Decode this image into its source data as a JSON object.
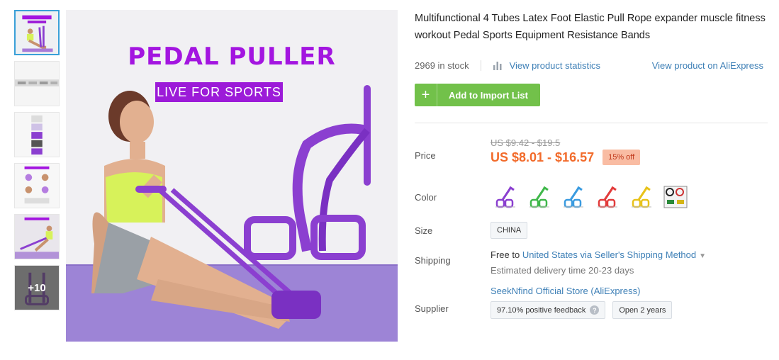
{
  "product": {
    "title": "Multifunctional 4 Tubes Latex Foot Elastic Pull Rope expander muscle fitness workout Pedal Sports Equipment Resistance Bands",
    "stock": "2969 in stock",
    "view_stats": "View product statistics",
    "view_ali": "View product on AliExpress",
    "import_button": "Add to Import List",
    "import_icon": "+"
  },
  "image": {
    "brand_title": "PEDAL PULLER",
    "brand_sub": "LIVE FOR SPORTS",
    "more_count": "+10"
  },
  "labels": {
    "price": "Price",
    "color": "Color",
    "size": "Size",
    "shipping": "Shipping",
    "supplier": "Supplier"
  },
  "price": {
    "old": "US $9.42 - $19.5",
    "current": "US $8.01 - $16.57",
    "discount": "15% off"
  },
  "colors": [
    {
      "name": "purple",
      "hex": "#8b3fd0"
    },
    {
      "name": "green",
      "hex": "#3fb84a"
    },
    {
      "name": "blue",
      "hex": "#3a9be0"
    },
    {
      "name": "red",
      "hex": "#e23b3b"
    },
    {
      "name": "yellow",
      "hex": "#e8c21a"
    },
    {
      "name": "set",
      "hex": "#333333"
    }
  ],
  "size": {
    "selected": "CHINA"
  },
  "shipping": {
    "prefix": "Free",
    "to": "to",
    "destination": "United States via Seller's Shipping Method",
    "estimate": "Estimated delivery time 20-23 days"
  },
  "supplier": {
    "store": "SeekNfind Official Store (AliExpress)",
    "feedback": "97.10% positive feedback",
    "open": "Open 2 years"
  },
  "theme": {
    "accent": "#3d7fb6",
    "import_green": "#72c14a",
    "price_orange": "#f26b2b",
    "brand_purple": "#a315e0"
  }
}
